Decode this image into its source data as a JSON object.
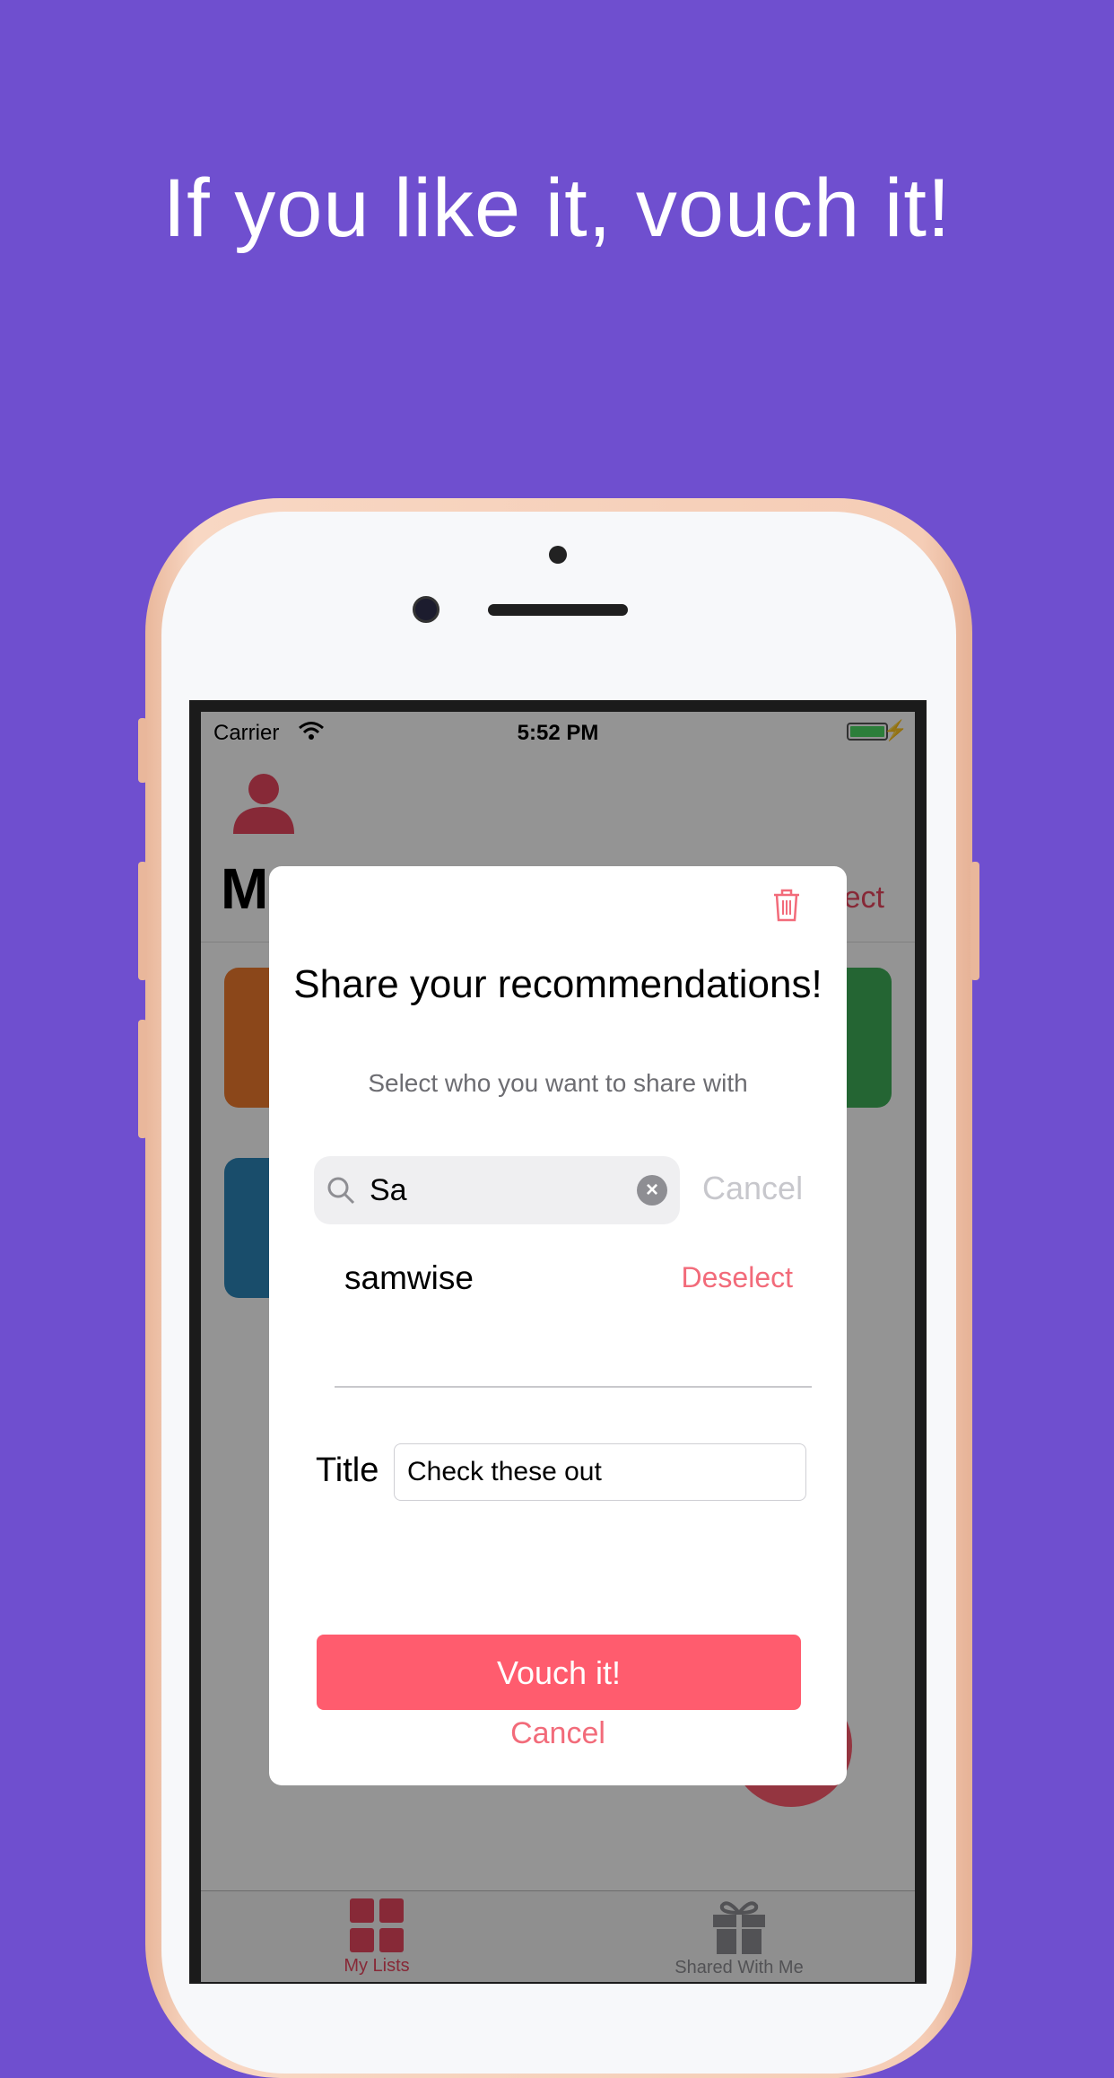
{
  "headline": "If you like it, vouch it!",
  "statusbar": {
    "carrier": "Carrier",
    "time": "5:52 PM"
  },
  "app": {
    "title": "M",
    "select_label": "ect"
  },
  "modal": {
    "title": "Share your recommendations!",
    "subtitle": "Select who you want to share with",
    "search": {
      "value": "Sa",
      "cancel_label": "Cancel"
    },
    "results": [
      {
        "name": "samwise",
        "action": "Deselect"
      }
    ],
    "title_field": {
      "label": "Title",
      "value": "Check these out"
    },
    "primary_button": "Vouch it!",
    "cancel_label": "Cancel"
  },
  "tabbar": {
    "tabs": [
      {
        "label": "My Lists",
        "icon": "grid-icon",
        "active": true
      },
      {
        "label": "Shared With Me",
        "icon": "gift-icon",
        "active": false
      }
    ]
  },
  "colors": {
    "background": "#6f4fcf",
    "accent": "#ff5c6e",
    "accent_text": "#f26b7a"
  }
}
